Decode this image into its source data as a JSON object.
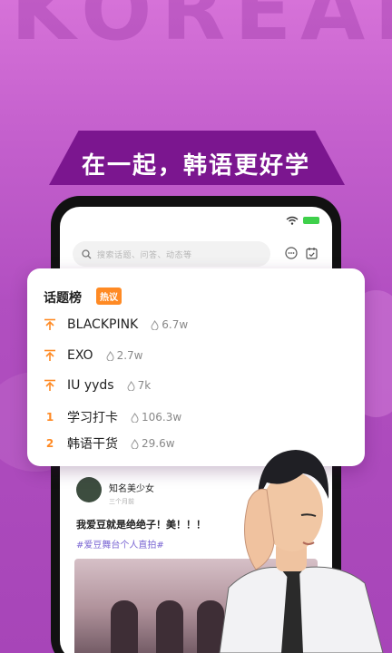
{
  "background_watermark": "KOREAN",
  "slogan": "在一起，韩语更好学",
  "search": {
    "placeholder": "搜索话题、问答、动态等"
  },
  "topic_card": {
    "title": "话题榜",
    "badge": "热议",
    "items": [
      {
        "rank": "",
        "rank_icon": "arrow-up-icon",
        "name": "BLACKPINK",
        "heat": "6.7w"
      },
      {
        "rank": "",
        "rank_icon": "arrow-up-icon",
        "name": "EXO",
        "heat": "2.7w"
      },
      {
        "rank": "",
        "rank_icon": "arrow-up-icon",
        "name": "IU yyds",
        "heat": "7k"
      },
      {
        "rank": "1",
        "rank_icon": "",
        "name": "学习打卡",
        "heat": "106.3w"
      },
      {
        "rank": "2",
        "rank_icon": "",
        "name": "韩语干货",
        "heat": "29.6w"
      }
    ]
  },
  "post": {
    "author": "知名美少女",
    "time": "三个月前",
    "text": "我爱豆就是绝绝子！美！！！",
    "tag": "#爱豆舞台个人直拍#"
  },
  "colors": {
    "accent": "#ff8a24",
    "brand_purple": "#7b168f",
    "tag": "#7a66d3"
  }
}
